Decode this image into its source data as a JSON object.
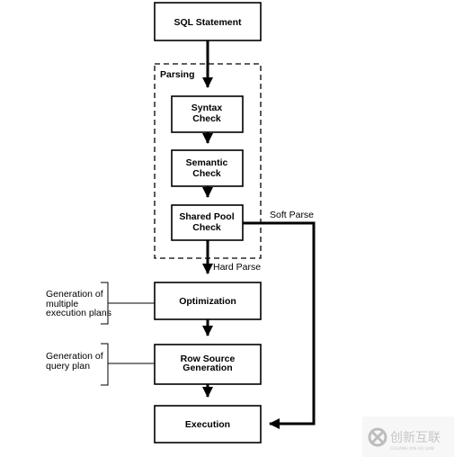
{
  "boxes": {
    "sql_statement": "SQL Statement",
    "parsing_label": "Parsing",
    "syntax": [
      "Syntax",
      "Check"
    ],
    "semantic": [
      "Semantic",
      "Check"
    ],
    "shared_pool": [
      "Shared Pool",
      "Check"
    ],
    "optimization": "Optimization",
    "row_source": [
      "Row Source",
      "Generation"
    ],
    "execution": "Execution"
  },
  "edge_labels": {
    "soft_parse": "Soft Parse",
    "hard_parse": "Hard Parse"
  },
  "annotations": {
    "optimization_note": [
      "Generation of",
      "multiple",
      "execution plans"
    ],
    "row_source_note": [
      "Generation of",
      "query plan"
    ]
  },
  "watermark": {
    "text": "创新互联",
    "subtext": "CHUANG XIN HU LIAN"
  }
}
